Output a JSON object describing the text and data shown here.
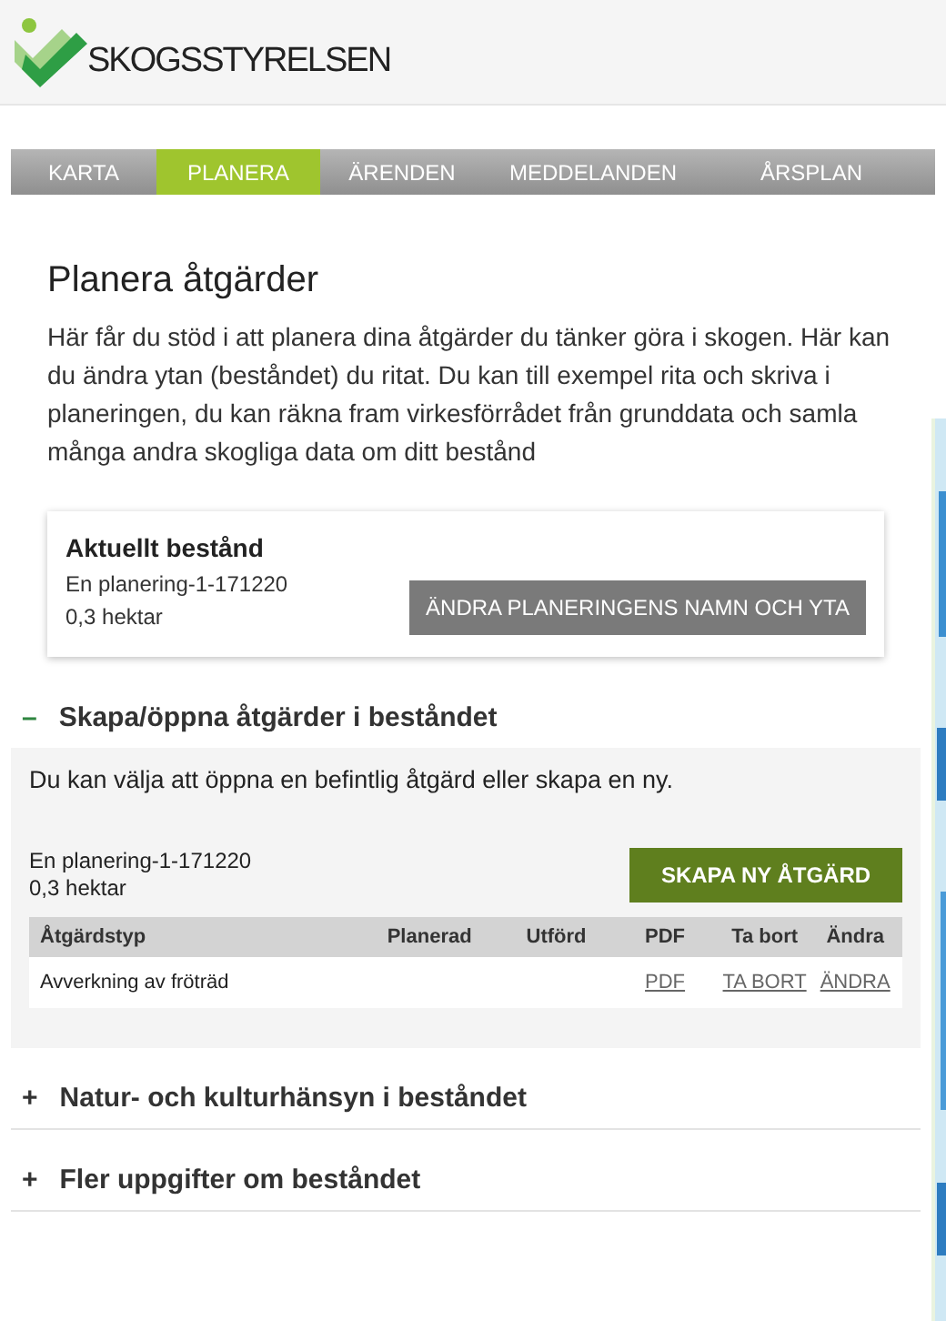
{
  "logo": {
    "text": "SKOGSSTYRELSEN"
  },
  "nav": [
    {
      "label": "KARTA",
      "selected": false
    },
    {
      "label": "PLANERA",
      "selected": true
    },
    {
      "label": "ÄRENDEN",
      "selected": false
    },
    {
      "label": "MEDDELANDEN",
      "selected": false
    },
    {
      "label": "ÅRSPLAN",
      "selected": false
    }
  ],
  "page": {
    "title": "Planera åtgärder",
    "intro": "Här får du stöd i att planera dina åtgärder du tänker göra i skogen. Här kan du ändra ytan (beståndet) du ritat. Du kan till exempel rita och skriva i planeringen, du kan räkna fram virkesförrådet från grunddata och samla många andra skogliga data om ditt bestånd"
  },
  "current_stand": {
    "title": "Aktuellt bestånd",
    "name": "En planering-1-171220",
    "area": "0,3 hektar",
    "button": "ÄNDRA PLANERINGENS NAMN OCH YTA"
  },
  "sections": [
    {
      "title": "Skapa/öppna åtgärder i beståndet",
      "icon": "–",
      "expanded": true,
      "body": {
        "text": "Du kan välja att öppna en befintlig åtgärd eller skapa en ny.",
        "name": "En planering-1-171220",
        "area": "0,3 hektar",
        "button": "SKAPA NY ÅTGÄRD",
        "table": {
          "columns": [
            "Åtgärdstyp",
            "Planerad",
            "Utförd",
            "PDF",
            "Ta bort",
            "Ändra"
          ],
          "rows": [
            [
              "Avverkning av fröträd",
              "",
              "",
              "PDF",
              "TA BORT",
              "ÄNDRA"
            ]
          ]
        }
      }
    },
    {
      "title": "Natur- och kulturhänsyn i beståndet",
      "icon": "+",
      "expanded": false
    },
    {
      "title": "Fler uppgifter om beståndet",
      "icon": "+",
      "expanded": false
    }
  ]
}
